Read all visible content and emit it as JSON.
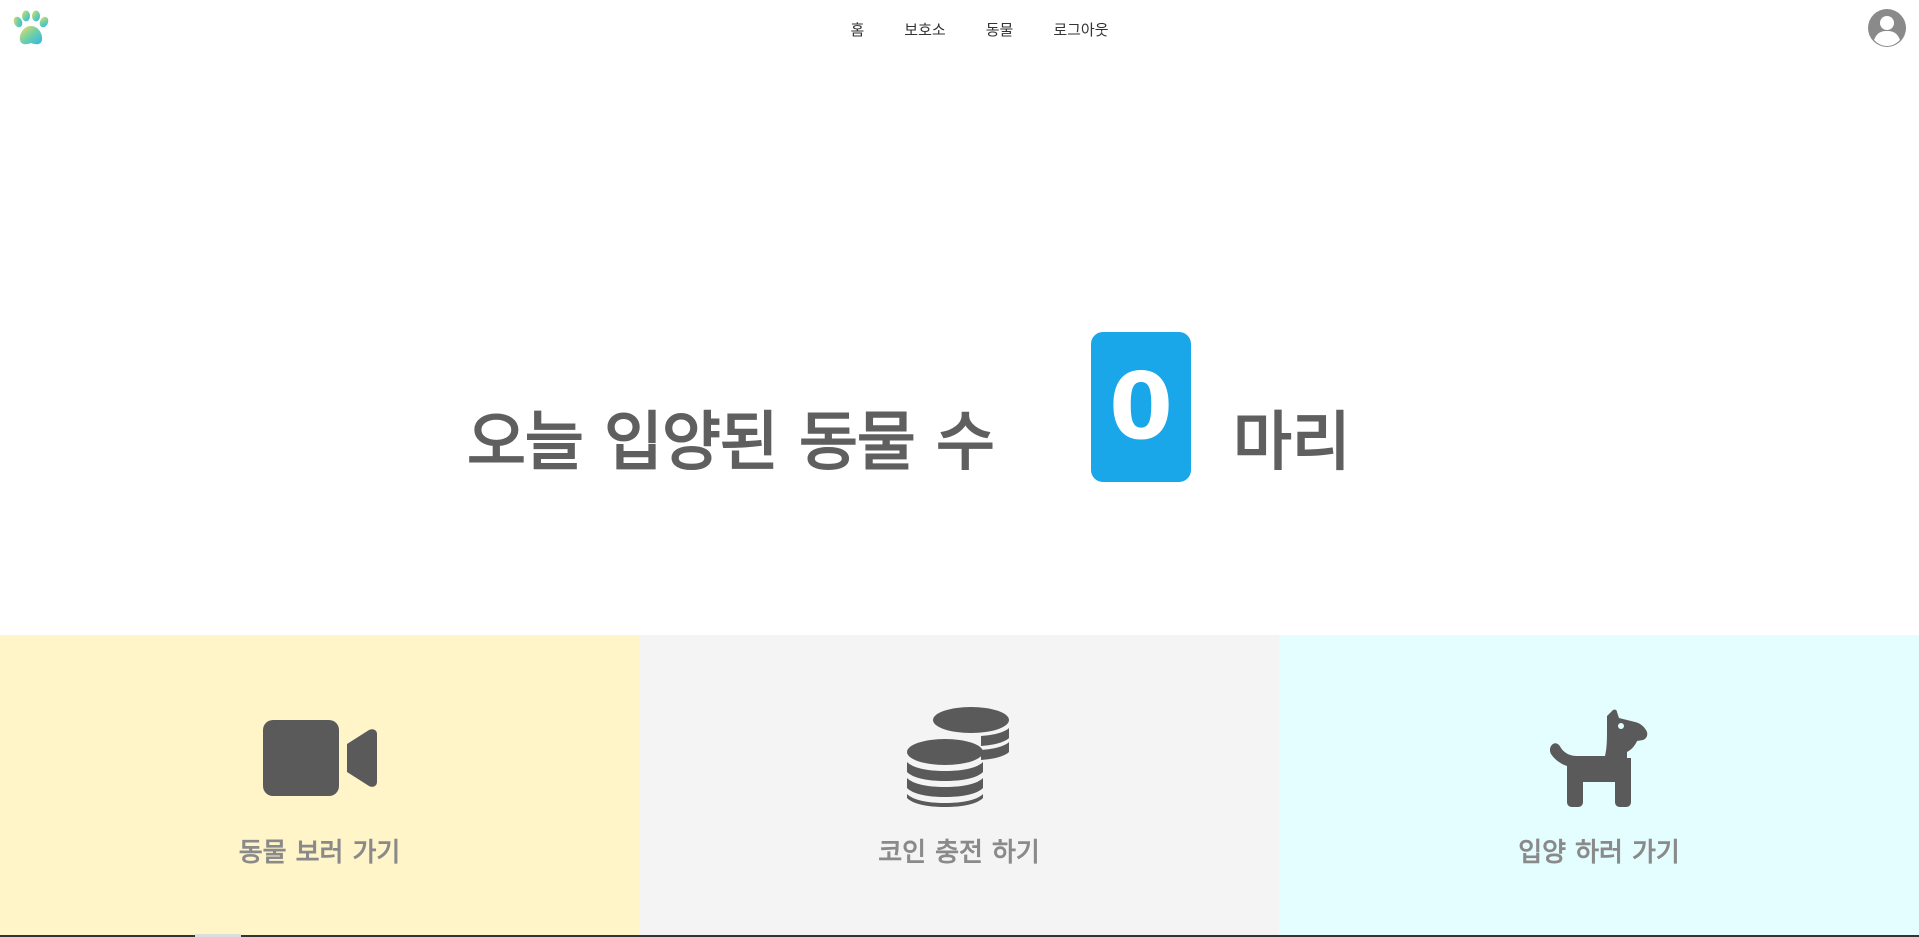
{
  "nav": {
    "items": [
      "홈",
      "보호소",
      "동물",
      "로그아웃"
    ]
  },
  "icons": {
    "logo": "paw-icon",
    "avatar": "user-avatar-icon",
    "card1": "video-camera-icon",
    "card2": "coins-icon",
    "card3": "dog-icon"
  },
  "hero": {
    "label": "오늘 입양된 동물 수",
    "count": "0",
    "unit": "마리"
  },
  "cards": [
    {
      "label": "동물 보러 가기",
      "bg": "#fff5c8"
    },
    {
      "label": "코인 충전 하기",
      "bg": "#f4f4f4"
    },
    {
      "label": "입양 하러 가기",
      "bg": "#e4fdfe"
    }
  ],
  "colors": {
    "counter_bg": "#19a7ea",
    "text_dark": "#5f5f5f",
    "icon_dark": "#5a5a5a"
  }
}
